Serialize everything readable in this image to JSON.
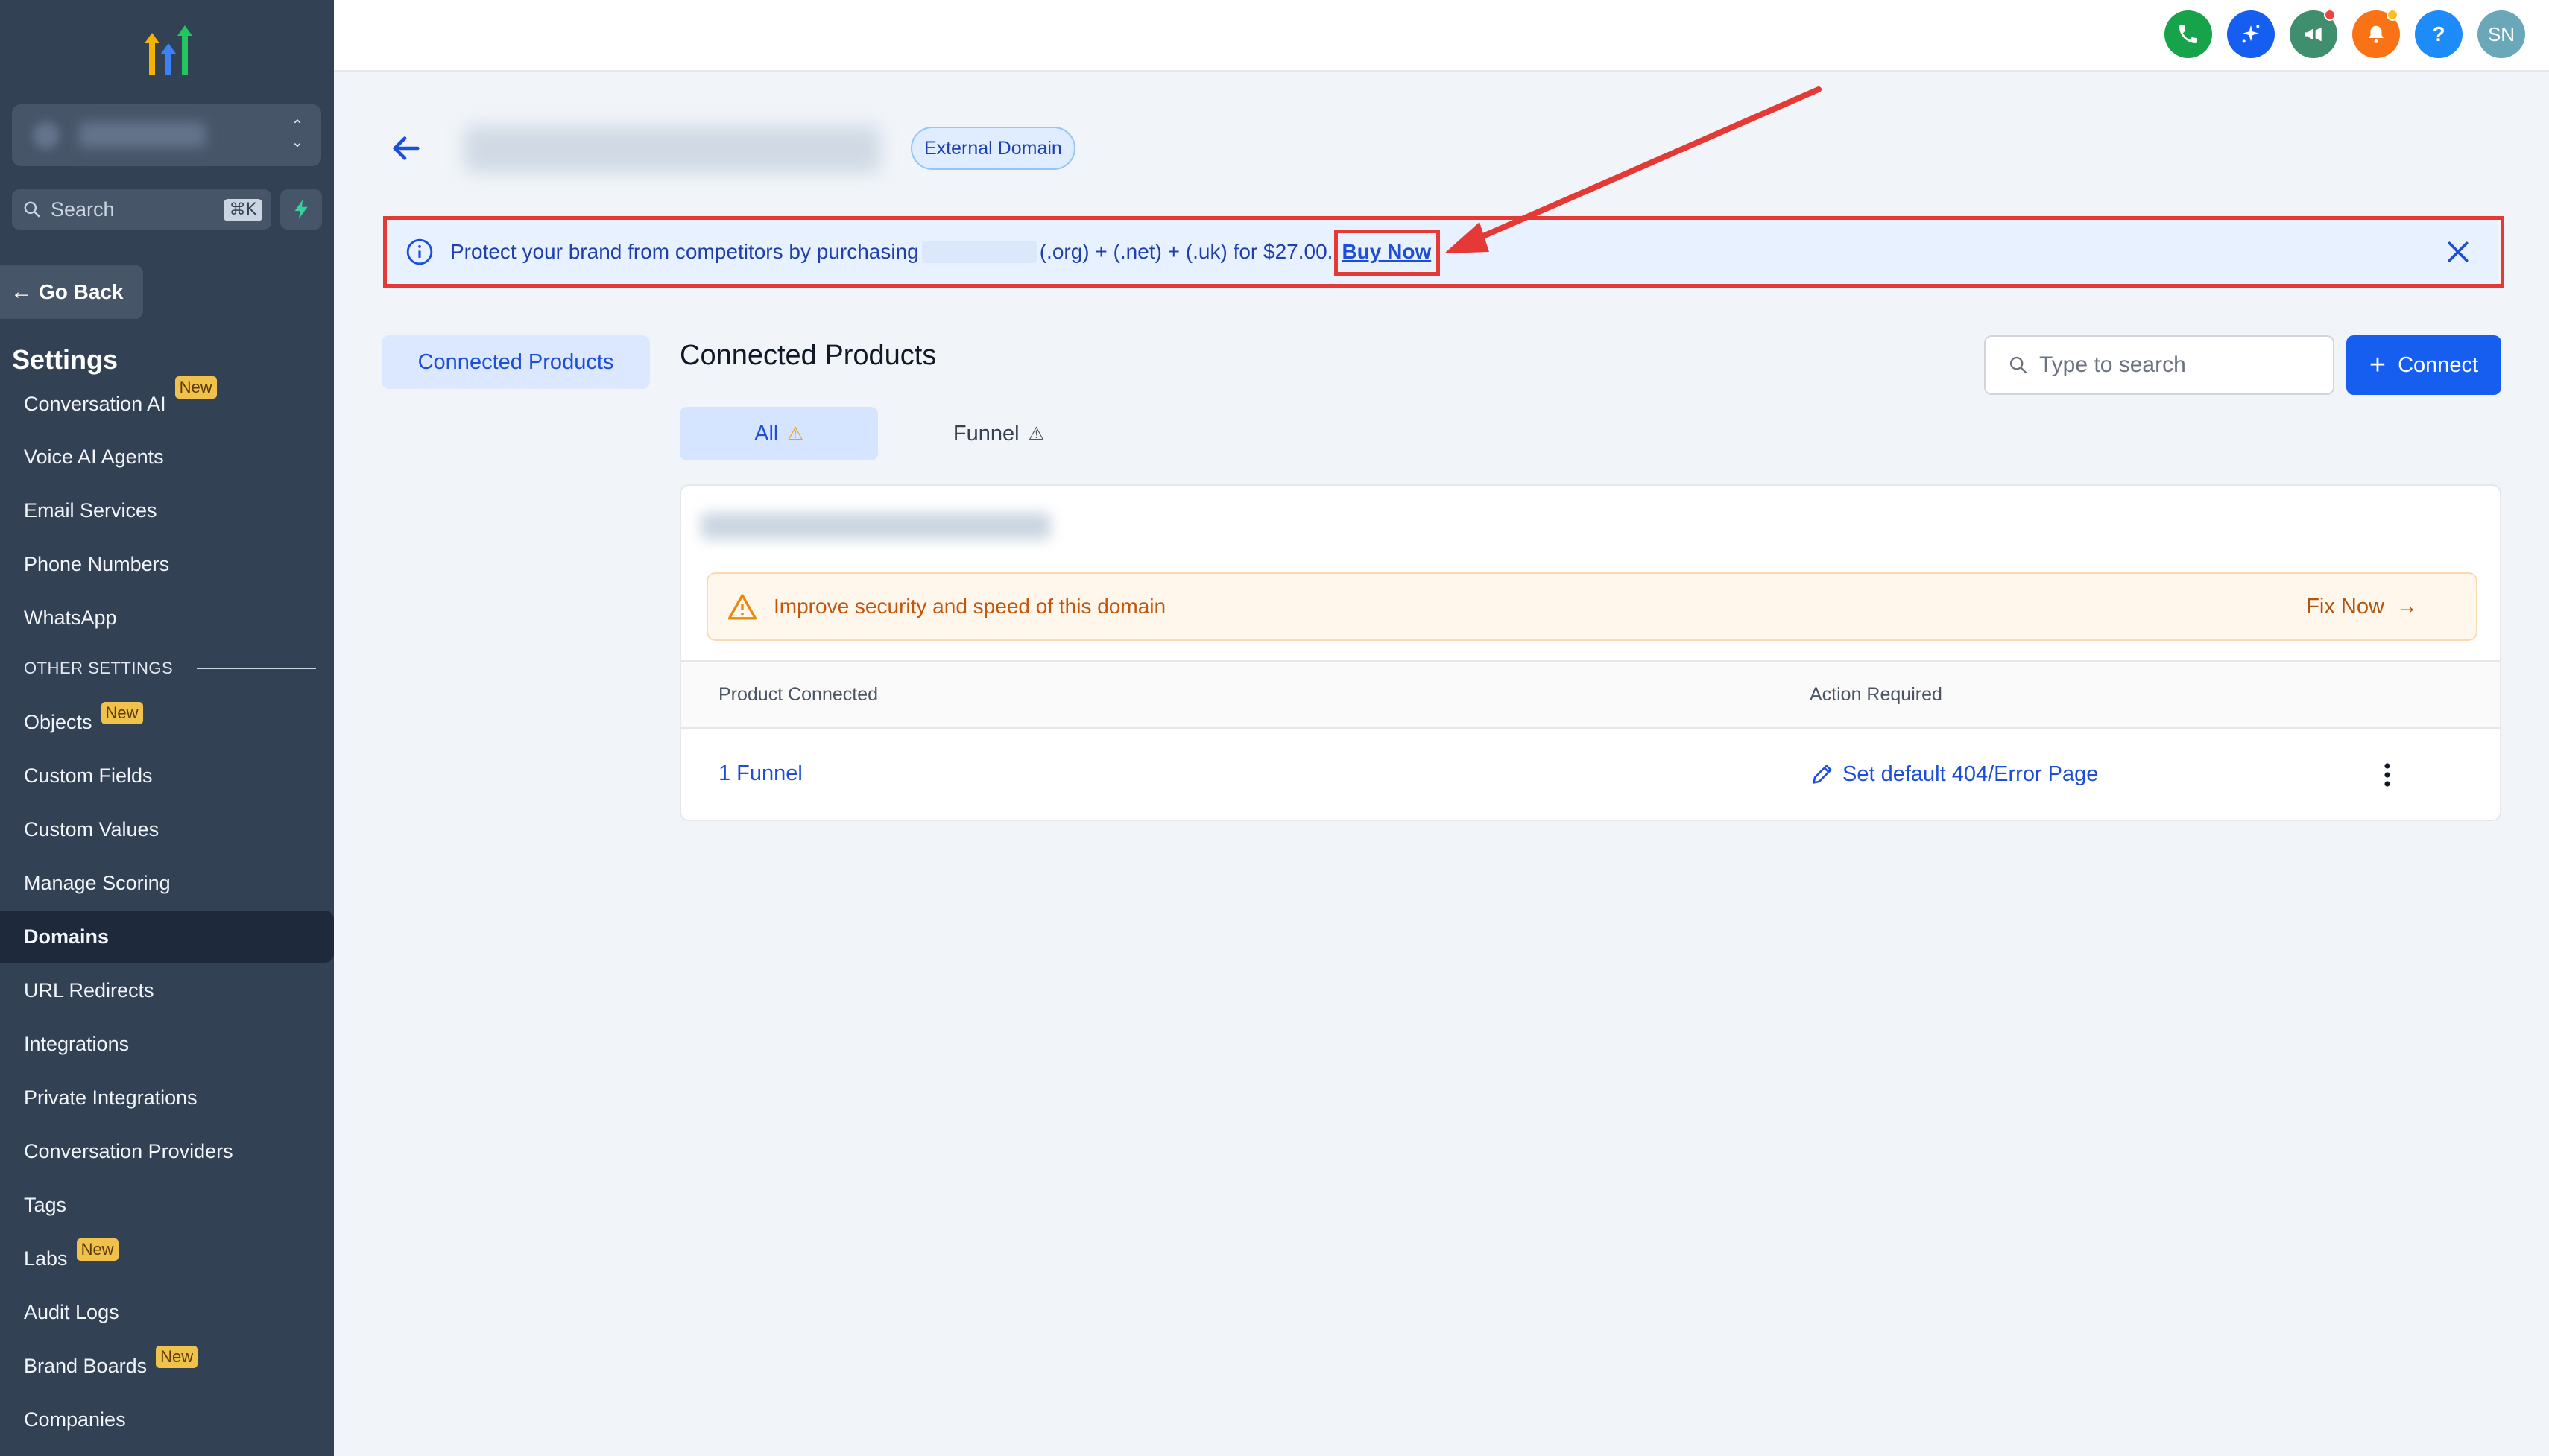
{
  "sidebar": {
    "search_label": "Search",
    "search_shortcut": "⌘K",
    "go_back": "Go Back",
    "settings_title": "Settings",
    "items": [
      {
        "label": "Conversation AI",
        "badge": "New"
      },
      {
        "label": "Voice AI Agents"
      },
      {
        "label": "Email Services"
      },
      {
        "label": "Phone Numbers"
      },
      {
        "label": "WhatsApp"
      }
    ],
    "other_settings_label": "OTHER SETTINGS",
    "other_items": [
      {
        "label": "Objects",
        "badge": "New"
      },
      {
        "label": "Custom Fields"
      },
      {
        "label": "Custom Values"
      },
      {
        "label": "Manage Scoring"
      },
      {
        "label": "Domains",
        "active": true
      },
      {
        "label": "URL Redirects"
      },
      {
        "label": "Integrations"
      },
      {
        "label": "Private Integrations"
      },
      {
        "label": "Conversation Providers"
      },
      {
        "label": "Tags"
      },
      {
        "label": "Labs",
        "badge": "New"
      },
      {
        "label": "Audit Logs"
      },
      {
        "label": "Brand Boards",
        "badge": "New"
      },
      {
        "label": "Companies"
      }
    ]
  },
  "topbar": {
    "avatar_initials": "SN",
    "help_label": "?",
    "colors": {
      "phone": "#16a34a",
      "sparkle": "#155eef",
      "megaphone": "#3f8f6e",
      "bell": "#f97316",
      "help": "#1d8cf8",
      "avatar": "#6aa7b8"
    }
  },
  "header": {
    "badge": "External Domain"
  },
  "banner": {
    "text_before": "Protect your brand from competitors by purchasing",
    "text_after": "(.org) + (.net) + (.uk) for $27.00.",
    "buy_now": "Buy Now"
  },
  "left_tab": "Connected Products",
  "main": {
    "title": "Connected Products",
    "search_placeholder": "Type to search",
    "connect_label": "Connect",
    "tabs": [
      {
        "label": "All",
        "active": true
      },
      {
        "label": "Funnel"
      }
    ],
    "alert_text": "Improve security and speed of this domain",
    "fix_now": "Fix Now",
    "table": {
      "headers": [
        "Product Connected",
        "Action Required"
      ],
      "rows": [
        {
          "product": "1 Funnel",
          "action": "Set default 404/Error Page"
        }
      ]
    }
  }
}
